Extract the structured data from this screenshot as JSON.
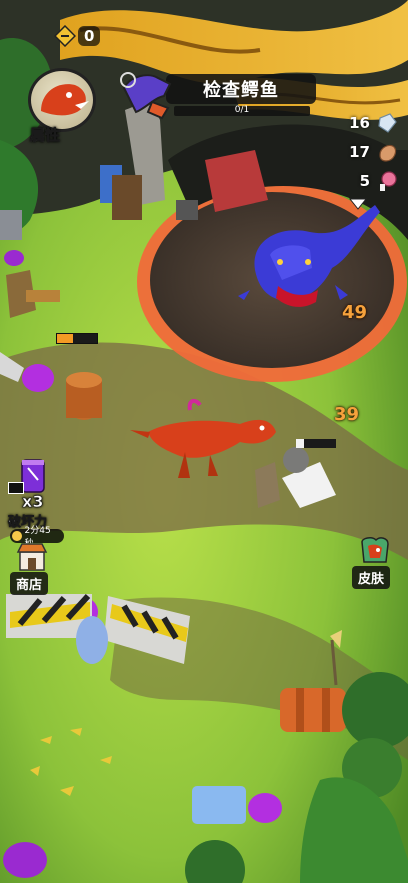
{
  "top_bar": {
    "currency_value": "0"
  },
  "quest": {
    "title": "检查鳄鱼",
    "progress": "0/1"
  },
  "resources": [
    {
      "value": "16",
      "icon": "crystal-icon"
    },
    {
      "value": "17",
      "icon": "meat-icon"
    },
    {
      "value": "5",
      "icon": "drumstick-icon"
    }
  ],
  "attributes_button": {
    "label": "属性"
  },
  "shop_button": {
    "label": "商店"
  },
  "skin_button": {
    "label": "皮肤"
  },
  "powerup": {
    "multiplier": "x3",
    "label": "破坏力",
    "timer": "2分45秒"
  },
  "enemy_damage": "49",
  "object_damage": "39",
  "player_health_percent": 40,
  "colors": {
    "accent_orange": "#f6a23c",
    "crocodile_blue": "#3b3bd6",
    "raptor_red": "#d8401b"
  }
}
